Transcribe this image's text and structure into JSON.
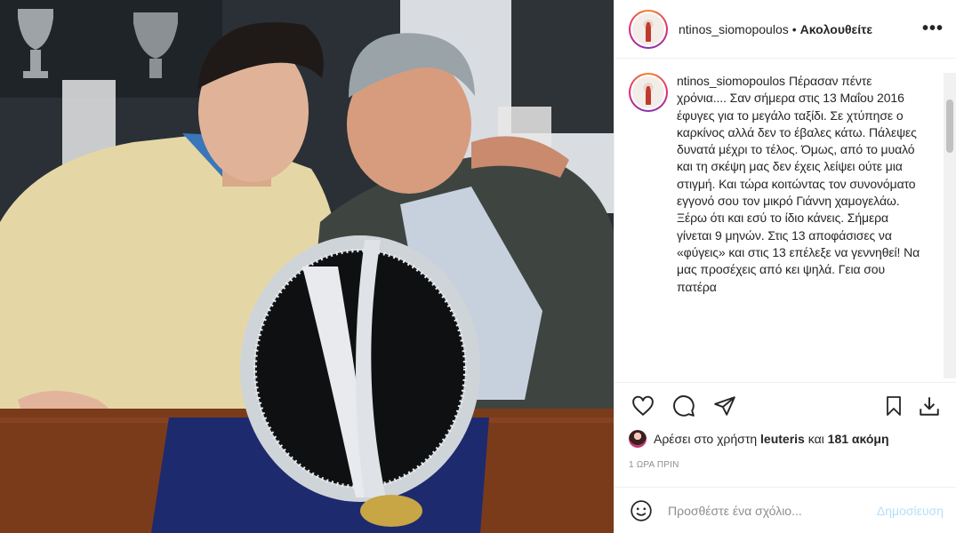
{
  "post": {
    "username": "ntinos_siomopoulos",
    "dot": "•",
    "follow_label": "Ακολουθείτε",
    "more_label": "•••",
    "caption_user": "ntinos_siomopoulos",
    "caption_text": "Πέρασαν πέντε χρόνια.... Σαν σήμερα στις 13 Μαΐου 2016 έφυγες για το μεγάλο ταξίδι. Σε χτύπησε ο καρκίνος αλλά δεν το έβαλες κάτω. Πάλεψες δυνατά μέχρι το τέλος. Όμως, από το μυαλό και τη σκέψη μας δεν έχεις λείψει ούτε μια στιγμή. Και τώρα κοιτώντας τον συνονόματο εγγονό σου τον μικρό Γιάννη χαμογελάω. Ξέρω ότι και εσύ το ίδιο κάνεις. Σήμερα γίνεται 9 μηνών. Στις 13 αποφάσισες να «φύγεις» και στις 13 επέλεξε να γεννηθεί! Να μας προσέχεις από κει ψηλά. Γεια σου πατέρα",
    "likes_prefix": "Αρέσει στο χρήστη",
    "likes_user": "leuteris",
    "likes_middle": "και",
    "likes_count": "181 ακόμη",
    "time_ago": "1 ΩΡΑ ΠΡΙΝ",
    "comment_placeholder": "Προσθέστε ένα σχόλιο...",
    "post_button": "Δημοσίευση"
  },
  "icons": {
    "like": "heart-icon",
    "comment": "comment-icon",
    "share": "share-icon",
    "save": "bookmark-icon",
    "download": "download-icon",
    "emoji": "emoji-icon"
  },
  "colors": {
    "text": "#262626",
    "muted": "#8e8e8e",
    "post_disabled": "#b2dffc",
    "border": "#efefef"
  }
}
